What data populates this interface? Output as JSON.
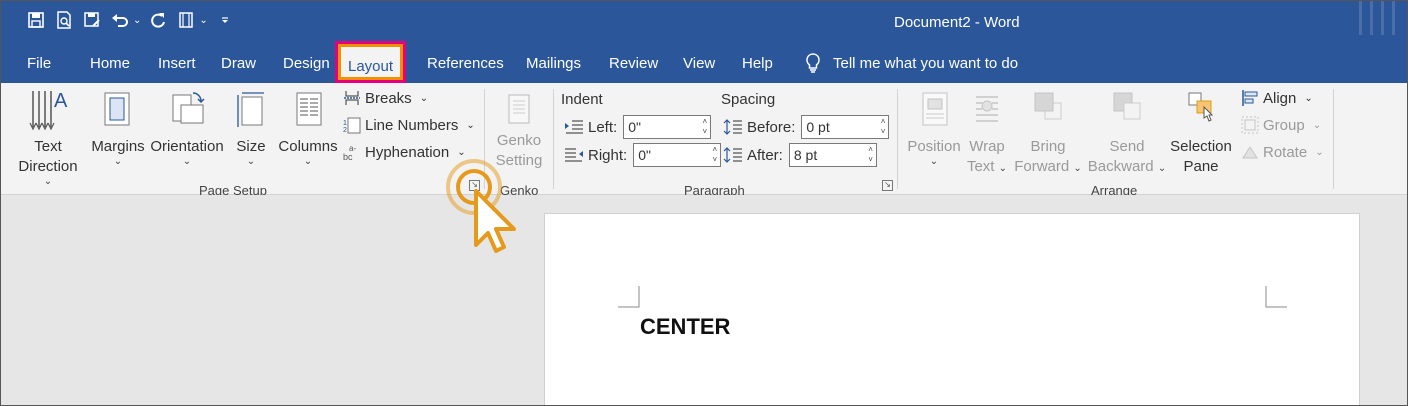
{
  "title_bar": {
    "doc_title": "Document2  -  Word"
  },
  "tabs": [
    {
      "label": "File"
    },
    {
      "label": "Home"
    },
    {
      "label": "Insert"
    },
    {
      "label": "Draw"
    },
    {
      "label": "Design"
    },
    {
      "label": "Layout"
    },
    {
      "label": "References"
    },
    {
      "label": "Mailings"
    },
    {
      "label": "Review"
    },
    {
      "label": "View"
    },
    {
      "label": "Help"
    }
  ],
  "tell_me": "Tell me what you want to do",
  "page_setup": {
    "text_direction_1": "Text",
    "text_direction_2": "Direction",
    "margins": "Margins",
    "orientation": "Orientation",
    "size": "Size",
    "columns": "Columns",
    "breaks": "Breaks",
    "line_numbers": "Line Numbers",
    "hyphenation": "Hyphenation",
    "group_label": "Page Setup"
  },
  "genko": {
    "line1": "Genko",
    "line2": "Setting",
    "group_label": "Genko"
  },
  "paragraph": {
    "indent_label": "Indent",
    "spacing_label": "Spacing",
    "left_label": "Left:",
    "left_value": "0\"",
    "right_label": "Right:",
    "right_value": "0\"",
    "before_label": "Before:",
    "before_value": "0 pt",
    "after_label": "After:",
    "after_value": "8 pt",
    "group_label": "Paragraph"
  },
  "arrange": {
    "position": "Position",
    "wrap_1": "Wrap",
    "wrap_2": "Text",
    "bring_1": "Bring",
    "bring_2": "Forward",
    "send_1": "Send",
    "send_2": "Backward",
    "selection_1": "Selection",
    "selection_2": "Pane",
    "align": "Align",
    "group": "Group",
    "rotate": "Rotate",
    "group_label": "Arrange"
  },
  "document": {
    "text": "CENTER"
  },
  "colors": {
    "accent": "#2b579a",
    "highlight_outer": "#e6007e",
    "highlight_inner": "#f29100"
  }
}
